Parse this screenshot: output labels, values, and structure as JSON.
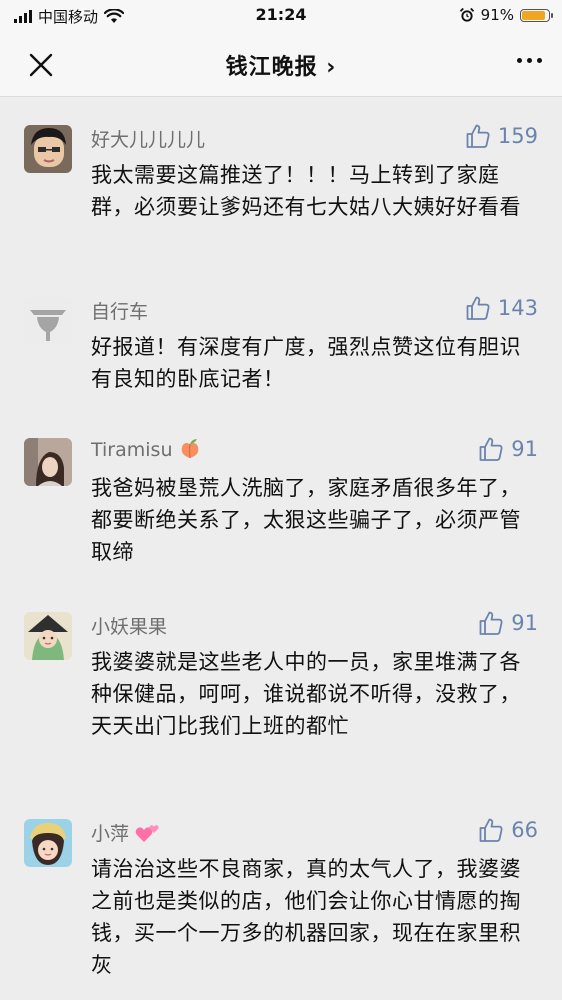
{
  "status_bar": {
    "carrier": "中国移动",
    "time": "21:24",
    "battery_text": "91%",
    "battery_level": 0.91
  },
  "nav": {
    "title": "钱江晚报",
    "chevron": "›"
  },
  "comments": [
    {
      "nickname": "好大儿儿儿儿",
      "likes": "159",
      "text": "我太需要这篇推送了！！！马上转到了家庭群，必须要让爹妈还有七大姑八大姨好好看看"
    },
    {
      "nickname": "自行车",
      "likes": "143",
      "text": "好报道！有深度有广度，强烈点赞这位有胆识有良知的卧底记者！"
    },
    {
      "nickname": "Tiramisu",
      "likes": "91",
      "text": "我爸妈被垦荒人洗脑了，家庭矛盾很多年了，都要断绝关系了，太狠这些骗子了，必须严管取缔"
    },
    {
      "nickname": "小妖果果",
      "likes": "91",
      "text": "我婆婆就是这些老人中的一员，家里堆满了各种保健品，呵呵，谁说都说不听得，没救了，天天出门比我们上班的都忙"
    },
    {
      "nickname": "小萍",
      "likes": "66",
      "text": "请治治这些不良商家，真的太气人了，我婆婆之前也是类似的店，他们会让你心甘情愿的掏钱，买一个一万多的机器回家，现在在家里积灰"
    }
  ],
  "icons": {
    "like": "thumbs-up-icon",
    "peach_emoji": "peach-icon",
    "hearts_emoji": "two-hearts-icon"
  },
  "colors": {
    "like": "#6a84ad",
    "nickname": "#6f6f6f",
    "battery": "#f0a623"
  }
}
